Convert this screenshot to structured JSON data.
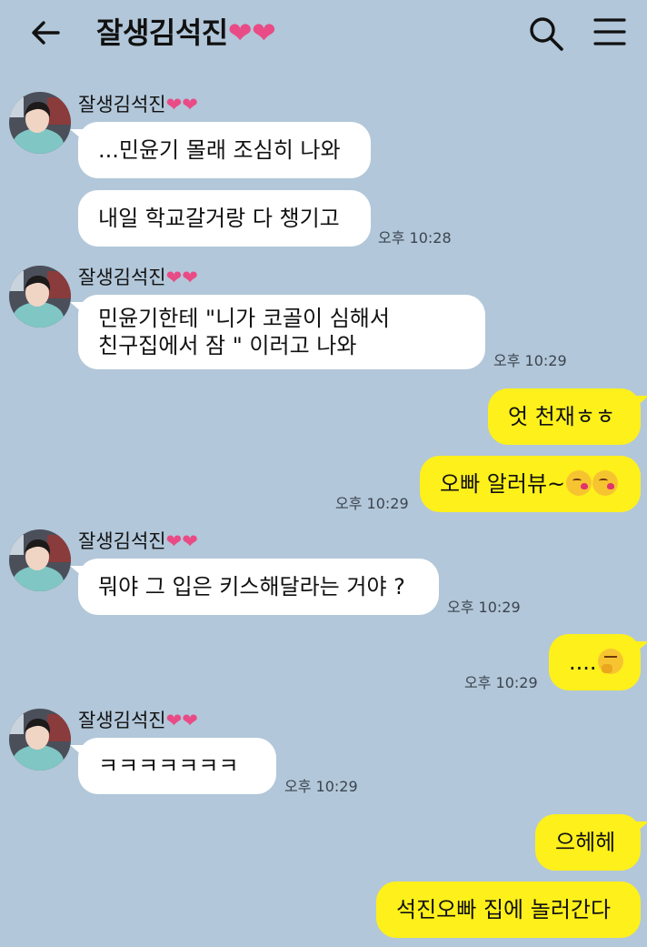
{
  "header": {
    "title": "잘생김석진",
    "title_hearts": "❤❤",
    "back_icon": "arrow-left-icon",
    "search_icon": "search-icon",
    "menu_icon": "hamburger-menu-icon"
  },
  "colors": {
    "background": "#b2c7d9",
    "incoming_bubble": "#ffffff",
    "outgoing_bubble": "#fef01b",
    "heart": "#e84b86"
  },
  "messages": {
    "g1": {
      "sender": "잘생김석진",
      "sender_hearts": "❤❤",
      "m1": "...민윤기 몰래 조심히 나와",
      "m2": "내일 학교갈거랑 다 챙기고",
      "time": "오후 10:28"
    },
    "g2": {
      "sender": "잘생김석진",
      "sender_hearts": "❤❤",
      "m1_line1": "민윤기한테 \"니가 코골이 심해서",
      "m1_line2": "친구집에서 잠 \" 이러고 나와",
      "time": "오후 10:29"
    },
    "out1": {
      "m1": "엇 천재ㅎㅎ",
      "m2": "오빠 알러뷰~",
      "m2_emoji": "kissing-face-emoji",
      "time": "오후 10:29"
    },
    "g3": {
      "sender": "잘생김석진",
      "sender_hearts": "❤❤",
      "m1": "뭐야 그 입은 키스해달라는 거야 ?",
      "time": "오후 10:29"
    },
    "out2": {
      "m1": "....",
      "m1_emoji": "thinking-face-emoji",
      "time": "오후 10:29"
    },
    "g4": {
      "sender": "잘생김석진",
      "sender_hearts": "❤❤",
      "m1": "ㅋㅋㅋㅋㅋㅋㅋ",
      "time": "오후 10:29"
    },
    "out3": {
      "m1": "으헤헤",
      "m2": "석진오빠 집에 놀러간다"
    }
  }
}
